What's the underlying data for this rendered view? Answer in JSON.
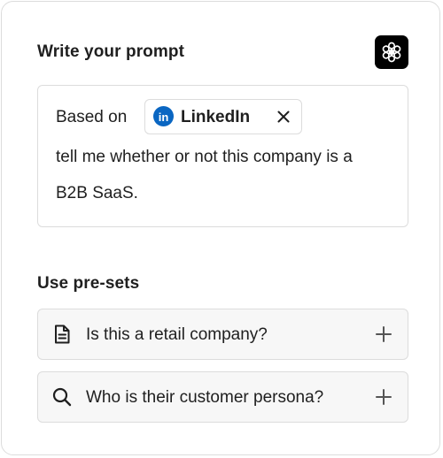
{
  "prompt_section": {
    "title": "Write your prompt",
    "brand_icon": "openai-icon",
    "text_before_chip": "Based on",
    "chip": {
      "label": "LinkedIn",
      "logo_text": "in",
      "logo_color": "#0a66c2",
      "logo_icon": "linkedin-icon",
      "remove_icon": "close-icon"
    },
    "text_line_2": "tell me whether or not this company is a",
    "text_line_3": "B2B SaaS."
  },
  "presets_section": {
    "title": "Use pre-sets",
    "items": [
      {
        "label": "Is this a retail company?",
        "icon": "document-icon",
        "action_icon": "plus-icon"
      },
      {
        "label": "Who is their customer persona?",
        "icon": "search-icon",
        "action_icon": "plus-icon"
      }
    ]
  },
  "colors": {
    "text": "#1f1f1f",
    "border": "#dcdcdc",
    "preset_bg": "#f7f7f7",
    "badge_bg": "#000000"
  }
}
